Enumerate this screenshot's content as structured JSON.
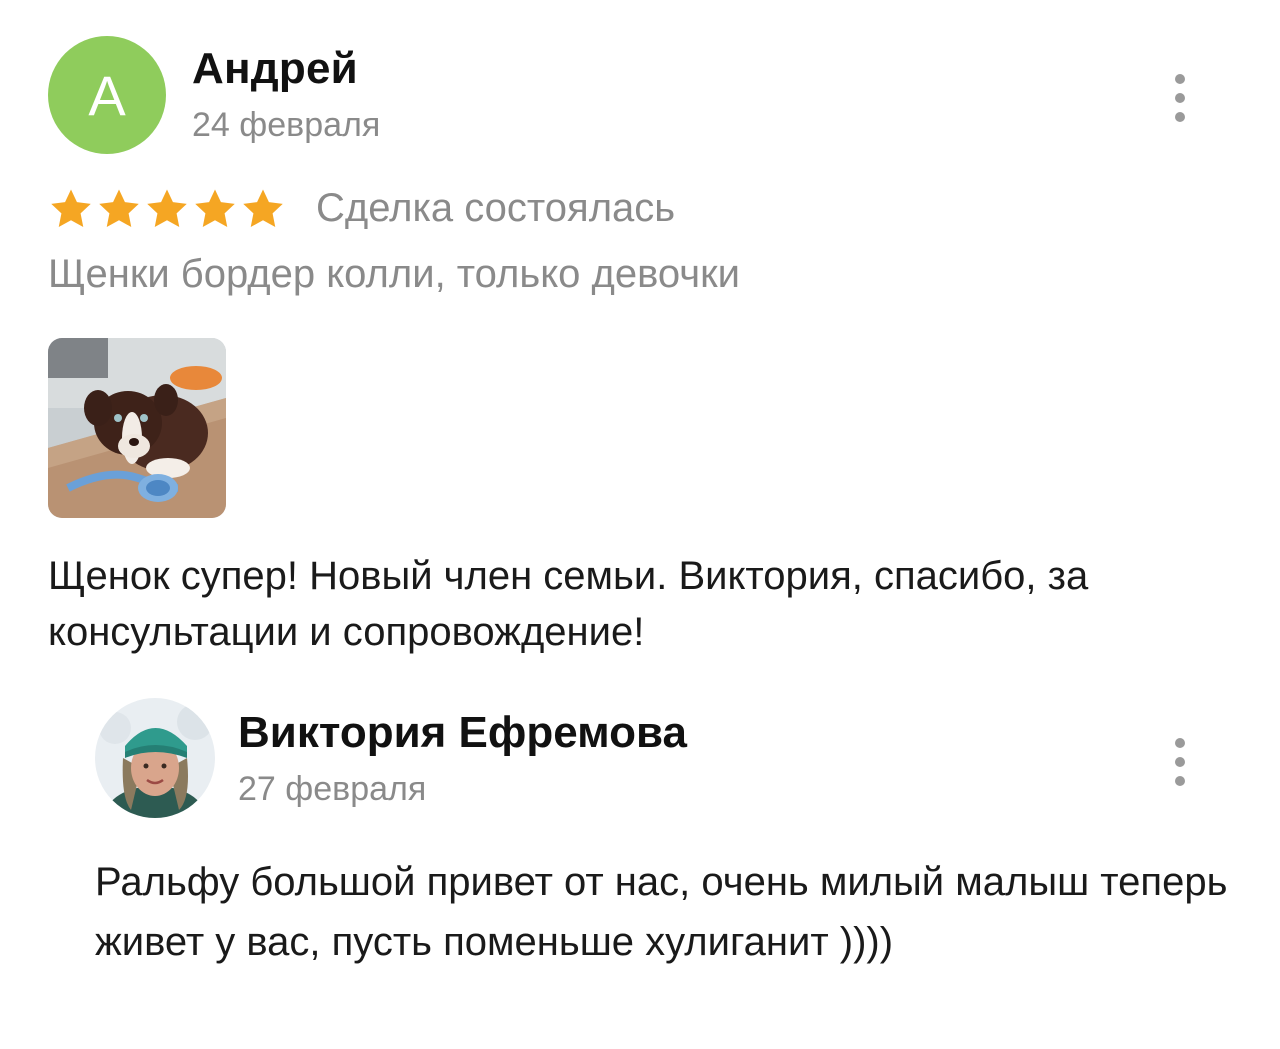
{
  "review": {
    "avatar_letter": "А",
    "author": "Андрей",
    "date": "24 февраля",
    "rating": 5,
    "deal_status": "Сделка состоялась",
    "listing_title": "Щенки бордер колли, только девочки",
    "text": "Щенок супер! Новый член семьи. Виктория, спасибо, за консультации и сопровождение!",
    "accent_color": "#8fcc5c",
    "star_color": "#f5a623"
  },
  "reply": {
    "author": "Виктория Ефремова",
    "date": "27 февраля",
    "text": "Ральфу большой привет от нас, очень милый малыш теперь живет у вас, пусть поменьше хулиганит ))))"
  }
}
